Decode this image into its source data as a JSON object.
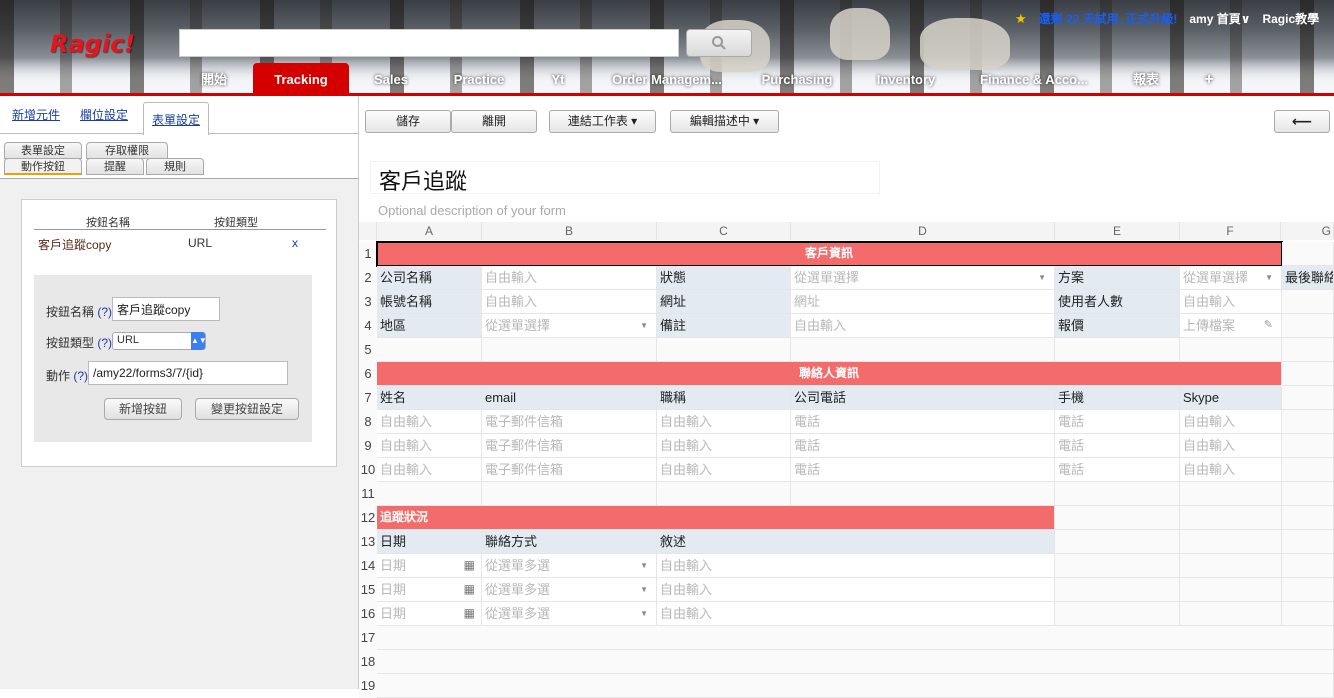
{
  "header": {
    "logo": "Ragic!",
    "search": {
      "placeholder": "",
      "button_icon": "search-icon"
    },
    "notice": "還剩 22 天試用, 正式升級!",
    "user": "amy 首頁",
    "user_caret": "∨",
    "account": "Ragic教學"
  },
  "nav": {
    "tabs": [
      {
        "label": "開始"
      },
      {
        "label": "Tracking",
        "active": true
      },
      {
        "label": "Sales"
      },
      {
        "label": "Practice"
      },
      {
        "label": "Yt"
      },
      {
        "label": "Order Managem..."
      },
      {
        "label": "Purchasing"
      },
      {
        "label": "Inventory"
      },
      {
        "label": "Finance & Acco..."
      },
      {
        "label": "報表"
      },
      {
        "label": "+"
      }
    ]
  },
  "left_panel": {
    "tabs": [
      "新增元件",
      "欄位設定",
      "表單設定"
    ],
    "sub_tabs_row1": [
      "表單設定",
      "存取權限"
    ],
    "sub_tabs_row2": [
      "動作按鈕",
      "提醒",
      "規則"
    ],
    "button_table": {
      "headers": [
        "按鈕名稱",
        "按鈕類型"
      ],
      "rows": [
        {
          "name": "客戶追蹤copy",
          "type": "URL",
          "delete": "x"
        }
      ]
    },
    "editor": {
      "name_label": "按鈕名稱",
      "type_label": "按鈕類型",
      "action_label": "動作",
      "help": "(?)",
      "name_value": "客戶追蹤copy",
      "type_value": "URL",
      "action_value": "/amy22/forms3/7/{id}",
      "add_button": "新增按鈕",
      "change_button": "變更按鈕設定"
    }
  },
  "toolbar": {
    "save": "儲存",
    "leave": "離開",
    "link_sheet": "連結工作表 ▾",
    "edit_desc": "編輯描述中 ▾",
    "back_icon": "⟵"
  },
  "form": {
    "title": "客戶追蹤",
    "description": "Optional description of your form"
  },
  "sheet": {
    "columns": [
      "A",
      "B",
      "C",
      "D",
      "E",
      "F",
      "G"
    ],
    "rows": [
      "1",
      "2",
      "3",
      "4",
      "5",
      "6",
      "7",
      "8",
      "9",
      "10",
      "11",
      "12",
      "13",
      "14",
      "15",
      "16",
      "17",
      "18",
      "19"
    ],
    "sections": {
      "customer": "客戶資訊",
      "contact": "聯絡人資訊",
      "tracking": "追蹤狀況"
    },
    "fields": {
      "company": "公司名稱",
      "status": "狀態",
      "plan": "方案",
      "last_contact": "最後聯絡",
      "account": "帳號名稱",
      "website": "網址",
      "user_count": "使用者人數",
      "region": "地區",
      "notes": "備註",
      "quote": "報價",
      "name": "姓名",
      "email": "email",
      "job_title": "職稱",
      "company_phone": "公司電話",
      "mobile": "手機",
      "skype": "Skype",
      "date": "日期",
      "contact_method": "聯絡方式",
      "narrative": "敘述"
    },
    "placeholders": {
      "free_input": "自由輸入",
      "select_one": "從選單選擇",
      "website": "網址",
      "upload": "上傳檔案",
      "email_box": "電子郵件信箱",
      "phone": "電話",
      "date": "日期",
      "multi_select": "從選單多選"
    }
  }
}
